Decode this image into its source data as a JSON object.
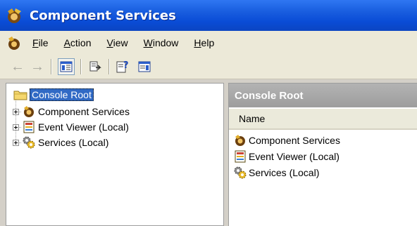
{
  "window": {
    "title": "Component Services"
  },
  "menu": [
    {
      "pre": "",
      "ul": "F",
      "post": "ile"
    },
    {
      "pre": "",
      "ul": "A",
      "post": "ction"
    },
    {
      "pre": "",
      "ul": "V",
      "post": "iew"
    },
    {
      "pre": "",
      "ul": "W",
      "post": "indow"
    },
    {
      "pre": "",
      "ul": "H",
      "post": "elp"
    }
  ],
  "tree": {
    "root": "Console Root",
    "items": [
      "Component Services",
      "Event Viewer (Local)",
      "Services (Local)"
    ]
  },
  "right_pane": {
    "header": "Console Root",
    "column": "Name",
    "items": [
      "Component Services",
      "Event Viewer (Local)",
      "Services (Local)"
    ]
  },
  "icons": {
    "app": "component-services-icon",
    "back": "back-arrow-icon",
    "forward": "forward-arrow-icon",
    "show_hide_tree": "show-hide-console-tree-icon",
    "export": "export-list-icon",
    "help": "help-icon",
    "show_hide_action": "show-hide-action-pane-icon"
  }
}
